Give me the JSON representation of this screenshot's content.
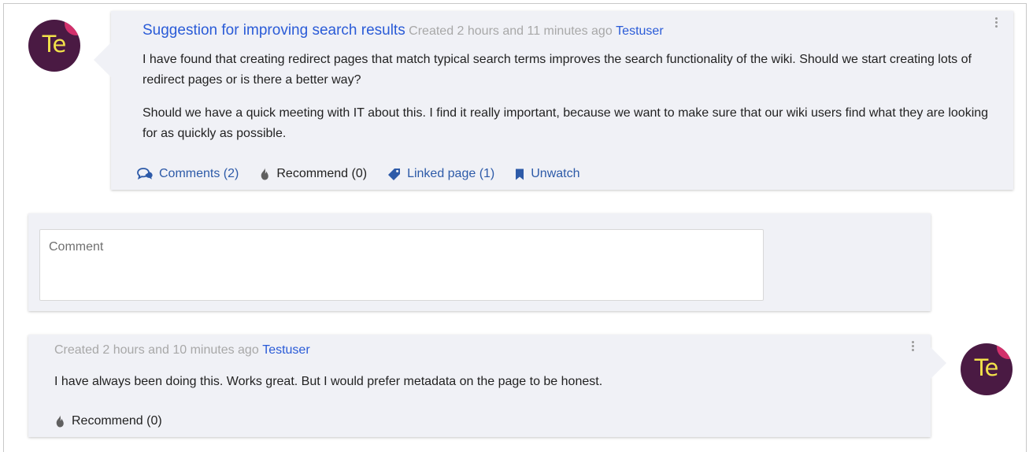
{
  "post": {
    "avatar_initials": "Te",
    "title": "Suggestion for improving search results",
    "created": "Created 2 hours and 11 minutes ago",
    "author": "Testuser",
    "paragraphs": [
      "I have found that creating redirect pages that match typical search terms improves the search functionality of the wiki. Should we start creating lots of redirect pages or is there a better way?",
      "Should we have a quick meeting with IT about this. I find it really important, because we want to make sure that our wiki users find what they are looking for as quickly as possible."
    ],
    "actions": {
      "comments": "Comments (2)",
      "recommend": "Recommend (0)",
      "linked_page": "Linked page (1)",
      "unwatch": "Unwatch"
    }
  },
  "comment_form": {
    "placeholder": "Comment"
  },
  "reply": {
    "avatar_initials": "Te",
    "created": "Created 2 hours and 10 minutes ago",
    "author": "Testuser",
    "text": "I have always been doing this. Works great. But I would prefer metadata on the page to be honest.",
    "recommend": "Recommend (0)"
  },
  "colors": {
    "link": "#2a5bd7",
    "action": "#2d5aa8",
    "card_bg": "#f0f1f6",
    "avatar_bg": "#4a1a43",
    "avatar_text": "#f2e24a",
    "avatar_accent": "#d2306b",
    "meta": "#a8a8a8"
  },
  "icons": [
    "comments-icon",
    "flame-icon",
    "tag-icon",
    "bookmark-icon",
    "kebab-menu-icon"
  ]
}
